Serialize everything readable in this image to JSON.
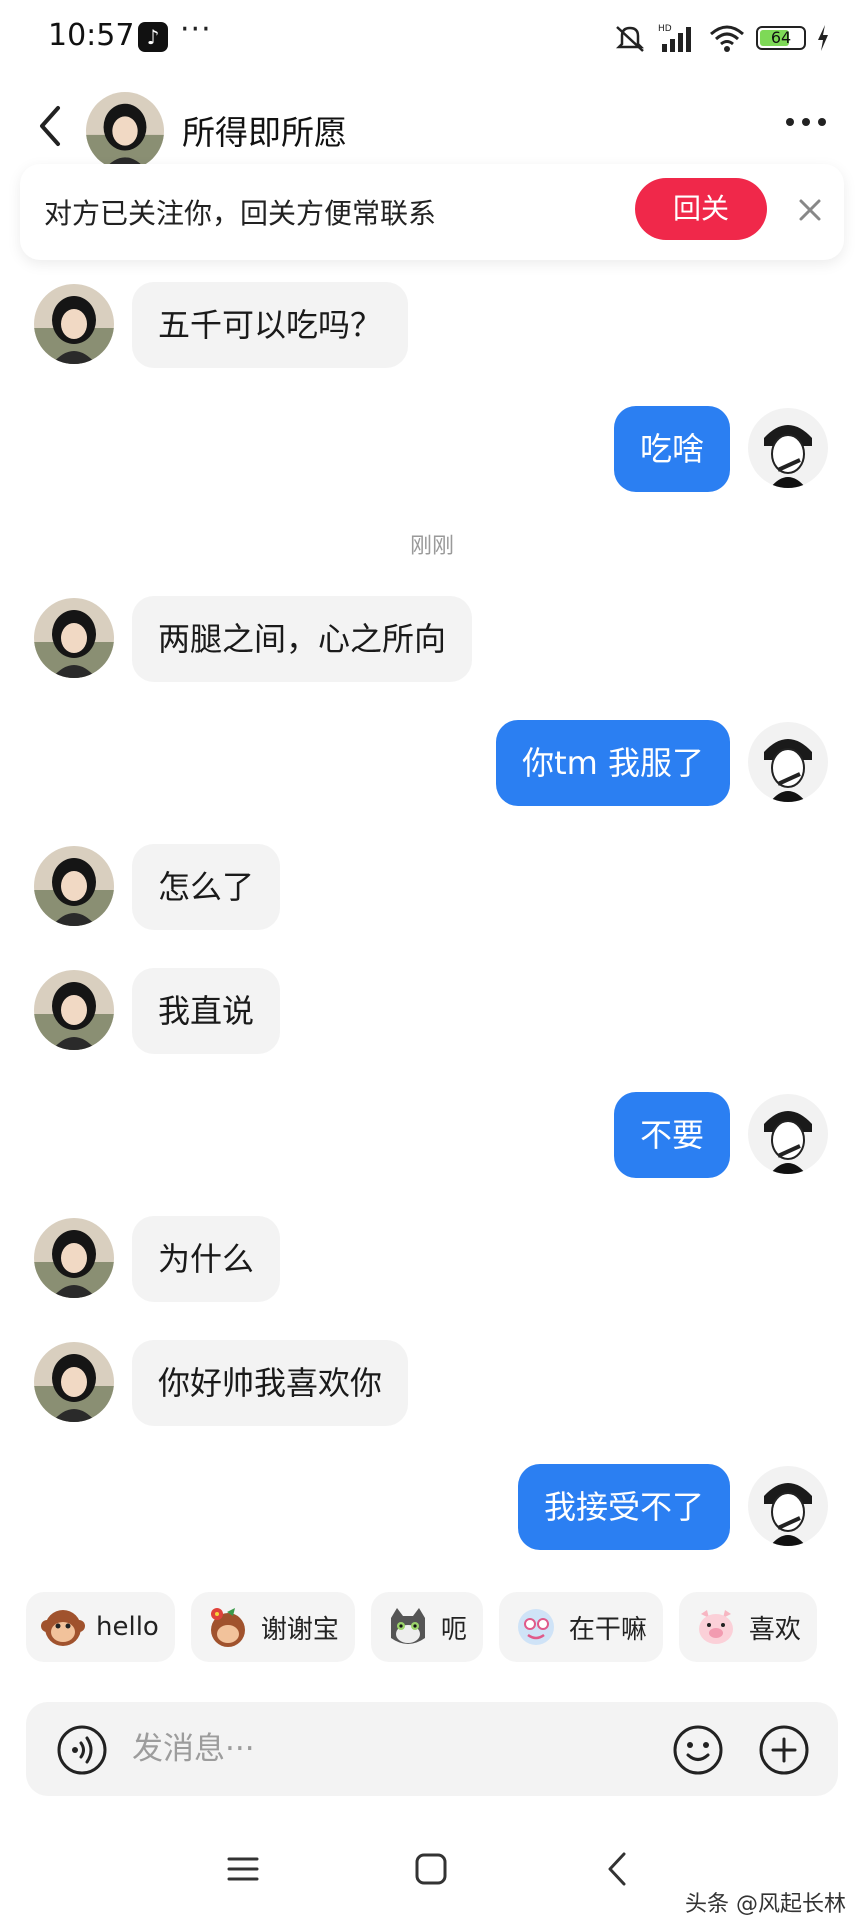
{
  "status_bar": {
    "time": "10:57",
    "dots": "···",
    "battery": "64"
  },
  "header": {
    "title": "所得即所愿"
  },
  "follow_banner": {
    "text": "对方已关注你，回关方便常联系",
    "button": "回关"
  },
  "messages": [
    {
      "side": "in",
      "text": "五千可以吃吗？"
    },
    {
      "side": "out",
      "text": "吃啥"
    },
    {
      "side": "in",
      "text": "两腿之间，心之所向"
    },
    {
      "side": "out",
      "text": "你tm 我服了"
    },
    {
      "side": "in",
      "text": "怎么了"
    },
    {
      "side": "in",
      "text": "我直说"
    },
    {
      "side": "out",
      "text": "不要"
    },
    {
      "side": "in",
      "text": "为什么"
    },
    {
      "side": "in",
      "text": "你好帅我喜欢你"
    },
    {
      "side": "out",
      "text": "我接受不了"
    }
  ],
  "timestamp": "刚刚",
  "quick_replies": [
    {
      "label": "hello",
      "icon": "monkey-emoji-icon"
    },
    {
      "label": "谢谢宝",
      "icon": "monkey-flower-emoji-icon"
    },
    {
      "label": "呃",
      "icon": "cat-emoji-icon"
    },
    {
      "label": "在干嘛",
      "icon": "cartoon-emoji-icon"
    },
    {
      "label": "喜欢",
      "icon": "pig-emoji-icon"
    }
  ],
  "input": {
    "placeholder": "发消息···"
  },
  "watermark": "头条 @风起长林",
  "colors": {
    "accent_blue": "#2b7ff2",
    "follow_red": "#f0284a",
    "bubble_gray": "#f3f3f3"
  }
}
